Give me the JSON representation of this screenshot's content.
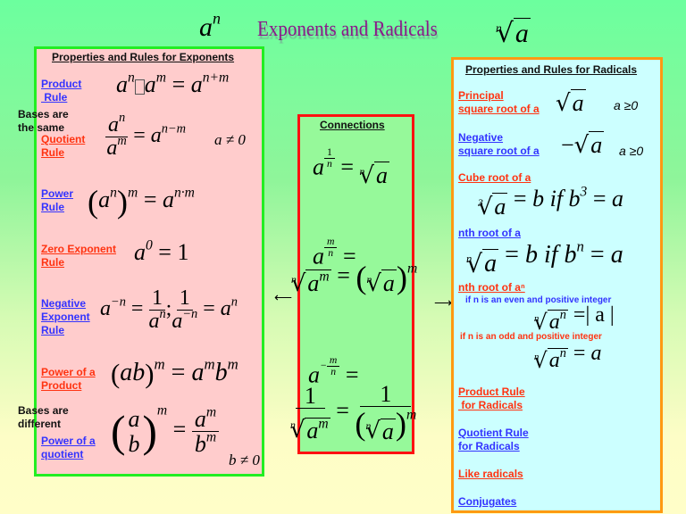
{
  "title": {
    "left_math": "a",
    "left_sup": "n",
    "text": "Exponents and Radicals",
    "right_index": "n",
    "right_radicand": "a"
  },
  "exponents": {
    "header": "Properties and Rules for Exponents",
    "bases_same": [
      "Bases are",
      "the same"
    ],
    "bases_different": [
      "Bases are",
      "different"
    ],
    "rules": [
      {
        "label": [
          "Product",
          " Rule"
        ],
        "color": "blue"
      },
      {
        "label": [
          "Quotient",
          "Rule"
        ],
        "color": "red",
        "condition": "a ≠ 0"
      },
      {
        "label": [
          "Power",
          "Rule"
        ],
        "color": "blue"
      },
      {
        "label": [
          "Zero Exponent",
          "Rule"
        ],
        "color": "red"
      },
      {
        "label": [
          "Negative",
          "Exponent",
          "Rule"
        ],
        "color": "blue"
      },
      {
        "label": [
          "Power of a",
          "Product"
        ],
        "color": "red"
      },
      {
        "label": [
          "Power of a",
          "quotient"
        ],
        "color": "blue",
        "condition": "b ≠ 0"
      }
    ],
    "formulas": {
      "product": "aⁿ·aᵐ = aⁿ⁺ᵐ",
      "quotient": "aⁿ/aᵐ = aⁿ⁻ᵐ",
      "power": "(aⁿ)ᵐ = aⁿ·ᵐ",
      "zero": "a⁰ = 1",
      "negative": "a⁻ⁿ = 1/aⁿ ; 1/a⁻ⁿ = aⁿ",
      "power_product": "(ab)ᵐ = aᵐbᵐ",
      "power_quotient": "(a/b)ᵐ = aᵐ/bᵐ"
    }
  },
  "connections": {
    "header": "Connections",
    "formulas": [
      "a^(1/n) = ⁿ√a",
      "a^(m/n) = ⁿ√(aᵐ) = (ⁿ√a)ᵐ",
      "a^(-m/n) = 1/ⁿ√(aᵐ) = 1/(ⁿ√a)ᵐ"
    ]
  },
  "radicals": {
    "header": "Properties and Rules for Radicals",
    "items": [
      {
        "label": [
          "Principal",
          "square root of a"
        ],
        "color": "red",
        "condition": "a ≥0"
      },
      {
        "label": [
          "Negative",
          "square root of a"
        ],
        "color": "blue",
        "condition": "a ≥0"
      },
      {
        "label": [
          "Cube root of a"
        ],
        "color": "red"
      },
      {
        "label": [
          "nth root of a"
        ],
        "color": "blue"
      },
      {
        "label": [
          "nth root of aⁿ"
        ],
        "color": "red"
      },
      {
        "label": [
          "Product Rule",
          " for Radicals"
        ],
        "color": "red"
      },
      {
        "label": [
          "Quotient Rule",
          "for Radicals"
        ],
        "color": "blue"
      },
      {
        "label": [
          "Like radicals"
        ],
        "color": "red"
      },
      {
        "label": [
          "Conjugates"
        ],
        "color": "blue"
      }
    ],
    "even_note": "if n is an even and positive integer",
    "odd_note": "if n is an odd and positive integer",
    "formulas": {
      "principal": "√a",
      "negative": "−√a",
      "cube": "∛a = b if b³ = a",
      "nth": "ⁿ√a = b if bⁿ = a",
      "even": "ⁿ√(aⁿ) = |a|",
      "odd": "ⁿ√(aⁿ) = a"
    }
  },
  "colors": {
    "exp_box_bg": "#ffcccc",
    "exp_box_border": "#22ee22",
    "conn_box_bg": "#96f99a",
    "conn_box_border": "#ff1111",
    "rad_box_bg": "#ccffff",
    "rad_box_border": "#ff9911",
    "link_blue": "#3333ff",
    "link_red": "#ff3311",
    "title": "#8a1a8a"
  }
}
